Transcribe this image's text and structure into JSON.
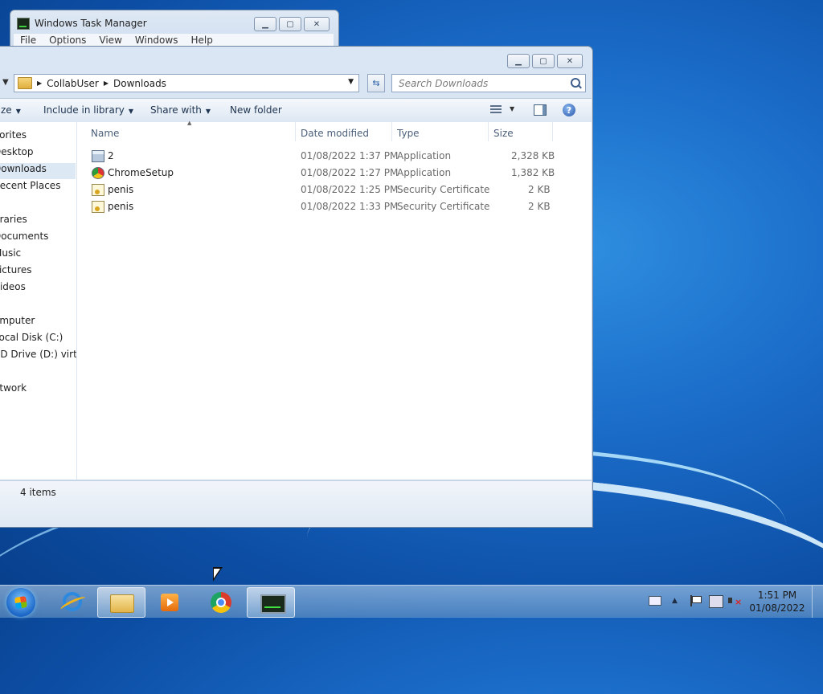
{
  "taskmanager": {
    "title": "Windows Task Manager",
    "menu": [
      "File",
      "Options",
      "View",
      "Windows",
      "Help"
    ]
  },
  "explorer": {
    "breadcrumb": [
      "CollabUser",
      "Downloads"
    ],
    "search_placeholder": "Search Downloads",
    "toolbar": {
      "organize": "ze",
      "include": "Include in library",
      "share": "Share with",
      "new_folder": "New folder"
    },
    "nav": [
      "vorites",
      "Desktop",
      "Downloads",
      "Recent Places",
      "braries",
      "Documents",
      "Music",
      "Pictures",
      "Videos",
      "omputer",
      "Local Disk (C:)",
      "CD Drive (D:) virtio-w",
      "etwork"
    ],
    "columns": [
      "Name",
      "Date modified",
      "Type",
      "Size"
    ],
    "files": [
      {
        "name": "2",
        "date": "01/08/2022 1:37 PM",
        "type": "Application",
        "size": "2,328 KB",
        "icon": "application-icon"
      },
      {
        "name": "ChromeSetup",
        "date": "01/08/2022 1:27 PM",
        "type": "Application",
        "size": "1,382 KB",
        "icon": "chrome-setup-icon"
      },
      {
        "name": "penis",
        "date": "01/08/2022 1:25 PM",
        "type": "Security Certificate",
        "size": "2 KB",
        "icon": "certificate-icon"
      },
      {
        "name": "penis",
        "date": "01/08/2022 1:33 PM",
        "type": "Security Certificate",
        "size": "2 KB",
        "icon": "certificate-icon"
      }
    ],
    "status": "4 items"
  },
  "taskbar": {
    "time": "1:51 PM",
    "date": "01/08/2022"
  }
}
